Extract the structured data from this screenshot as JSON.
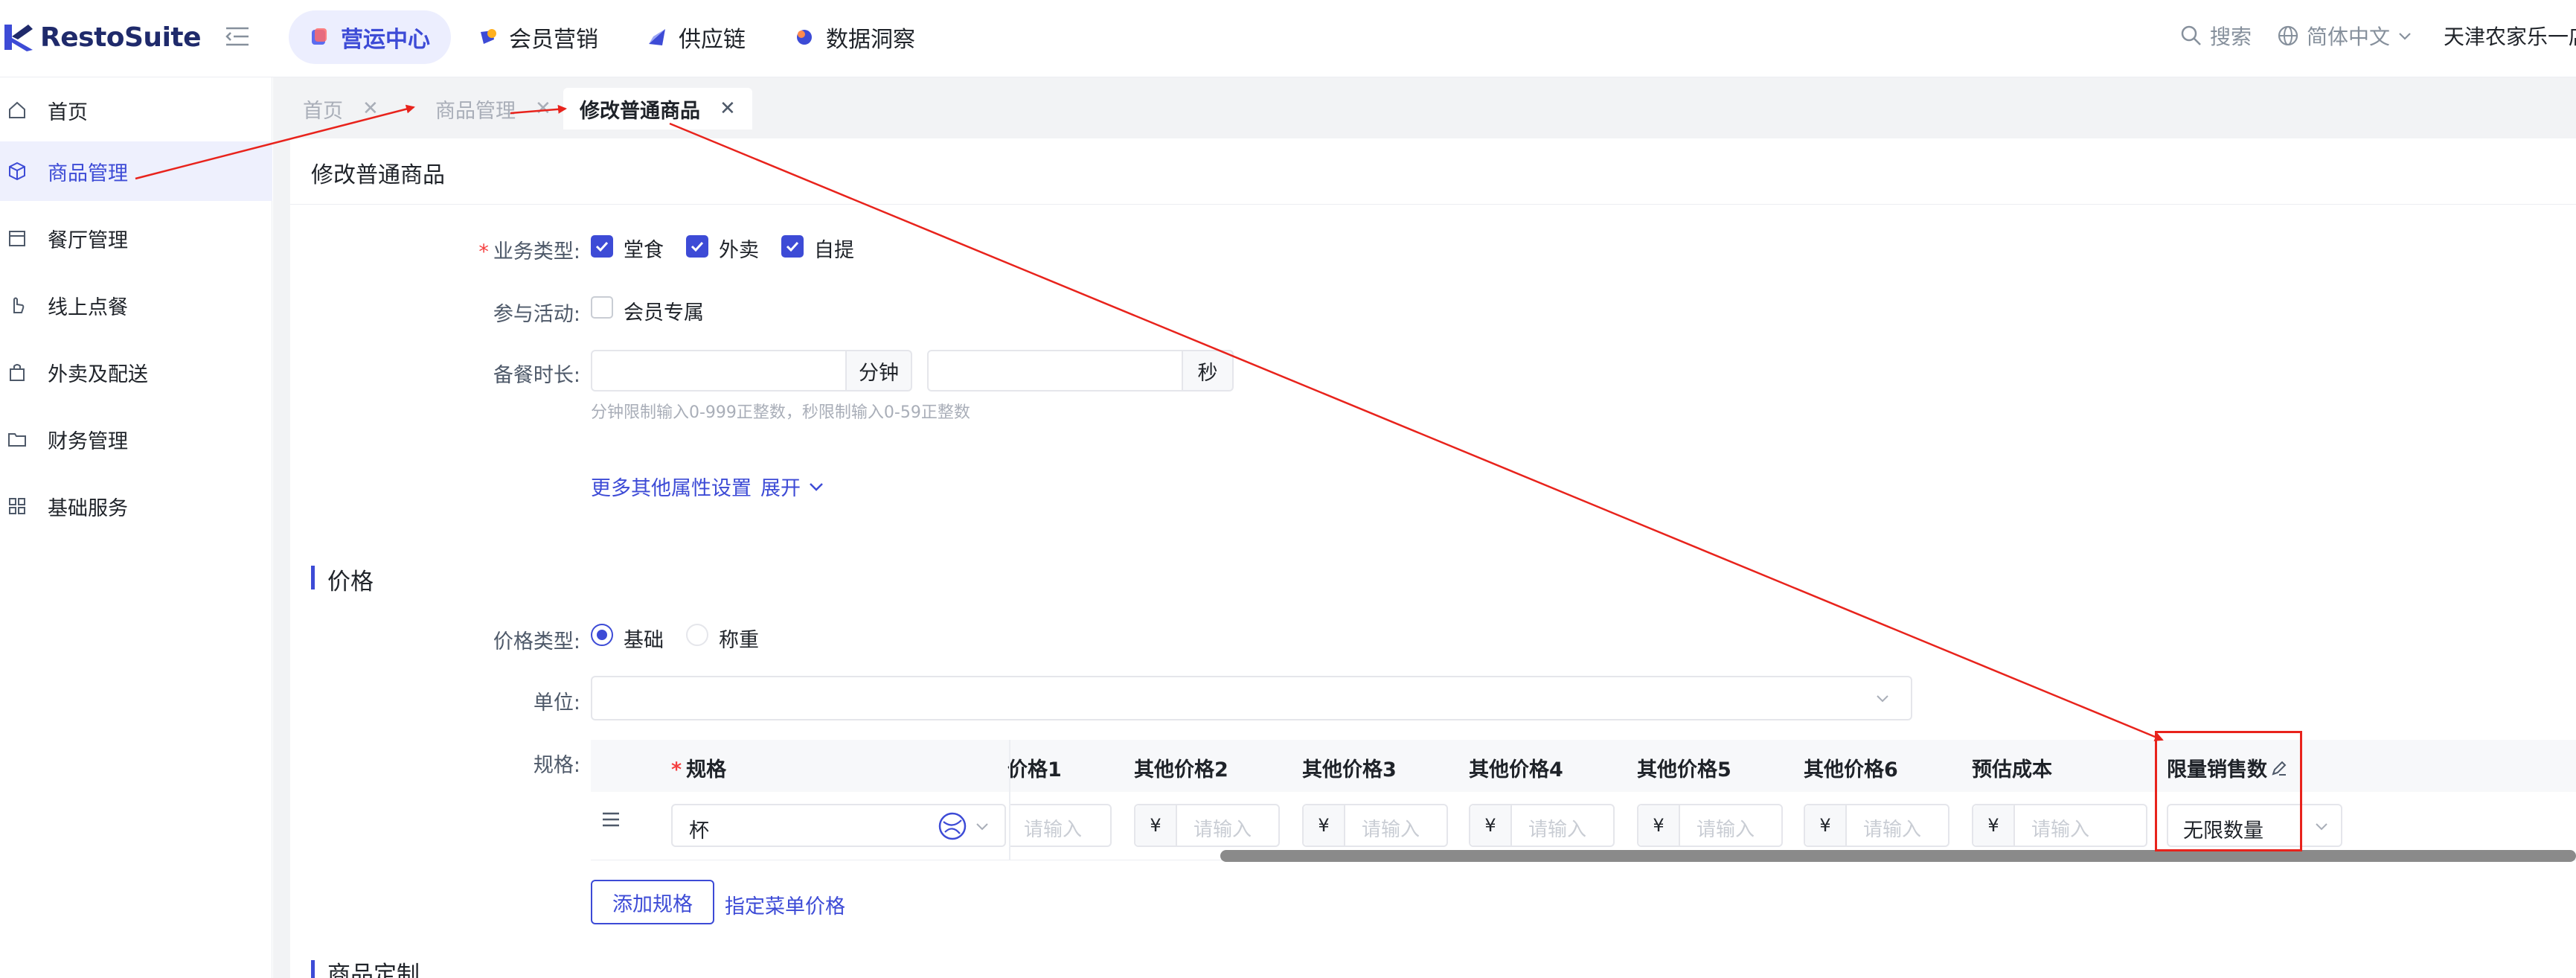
{
  "app": {
    "logo_text": "RestoSuite"
  },
  "topnav": {
    "items": [
      {
        "label": "营运中心",
        "active": true
      },
      {
        "label": "会员营销",
        "active": false
      },
      {
        "label": "供应链",
        "active": false
      },
      {
        "label": "数据洞察",
        "active": false
      }
    ],
    "search_label": "搜索",
    "language_label": "简体中文",
    "store_name": "天津农家乐一店"
  },
  "sidebar": {
    "items": [
      {
        "label": "首页",
        "icon": "home-icon",
        "active": false
      },
      {
        "label": "商品管理",
        "icon": "cube-icon",
        "active": true
      },
      {
        "label": "餐厅管理",
        "icon": "store-icon",
        "active": false
      },
      {
        "label": "线上点餐",
        "icon": "hand-icon",
        "active": false
      },
      {
        "label": "外卖及配送",
        "icon": "bag-icon",
        "active": false
      },
      {
        "label": "财务管理",
        "icon": "folder-icon",
        "active": false
      },
      {
        "label": "基础服务",
        "icon": "grid-icon",
        "active": false
      }
    ]
  },
  "tabs": [
    {
      "label": "首页",
      "close": "✕",
      "active": false
    },
    {
      "label": "商品管理",
      "close": "✕",
      "active": false
    },
    {
      "label": "修改普通商品",
      "close": "✕",
      "active": true
    }
  ],
  "page": {
    "title": "修改普通商品",
    "business_type": {
      "label": "业务类型:",
      "required": "*",
      "options": [
        {
          "label": "堂食",
          "checked": true
        },
        {
          "label": "外卖",
          "checked": true
        },
        {
          "label": "自提",
          "checked": true
        }
      ]
    },
    "activity": {
      "label": "参与活动:",
      "option": "会员专属",
      "checked": false
    },
    "prep_time": {
      "label": "备餐时长:",
      "minutes_value": "",
      "minutes_unit": "分钟",
      "seconds_value": "",
      "seconds_unit": "秒",
      "hint": "分钟限制输入0-999正整数，秒限制输入0-59正整数"
    },
    "more_settings": {
      "label": "更多其他属性设置",
      "expand": "展开"
    }
  },
  "price_section": {
    "title": "价格",
    "price_type": {
      "label": "价格类型:",
      "options": [
        {
          "label": "基础",
          "selected": true
        },
        {
          "label": "称重",
          "selected": false
        }
      ]
    },
    "unit": {
      "label": "单位:",
      "value": ""
    },
    "spec": {
      "label": "规格:",
      "headers": {
        "spec": "规格",
        "spec_required": "*",
        "price1": "价格1",
        "other2": "其他价格2",
        "other3": "其他价格3",
        "other4": "其他价格4",
        "other5": "其他价格5",
        "other6": "其他价格6",
        "cost": "预估成本",
        "limit": "限量销售数"
      },
      "row": {
        "spec_value": "杯",
        "currency": "¥",
        "placeholder": "请输入",
        "limit_value": "无限数量"
      }
    },
    "add_spec_button": "添加规格",
    "menu_price_link": "指定菜单价格"
  },
  "next_section": {
    "title": "商品定制"
  },
  "colors": {
    "accent": "#3d4bd6",
    "annotation": "#e8231c",
    "required": "#f53f3f"
  }
}
